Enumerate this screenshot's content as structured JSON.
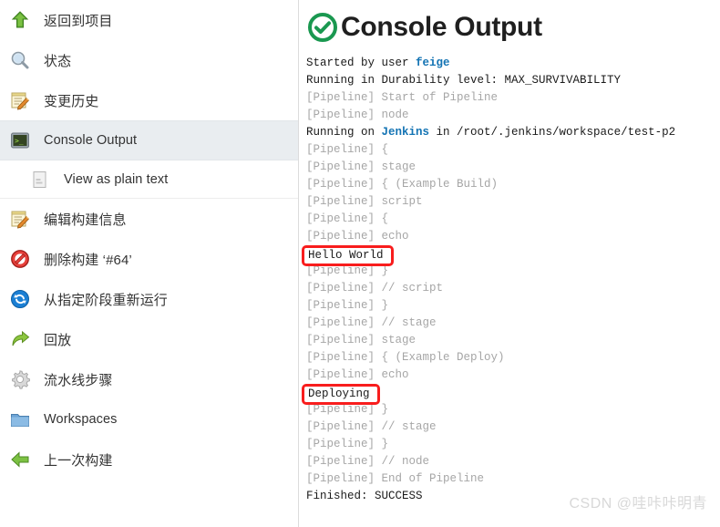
{
  "sidebar": {
    "items": [
      {
        "label": "返回到项目",
        "icon": "up-arrow-icon",
        "selected": false,
        "sub": false
      },
      {
        "label": "状态",
        "icon": "magnifier-icon",
        "selected": false,
        "sub": false
      },
      {
        "label": "变更历史",
        "icon": "notepad-pencil-icon",
        "selected": false,
        "sub": false
      },
      {
        "label": "Console Output",
        "icon": "terminal-icon",
        "selected": true,
        "sub": false
      },
      {
        "label": "View as plain text",
        "icon": "document-icon",
        "selected": false,
        "sub": true
      },
      {
        "label": "编辑构建信息",
        "icon": "notepad-pencil-icon",
        "selected": false,
        "sub": false
      },
      {
        "label": "删除构建 ‘#64’",
        "icon": "no-entry-icon",
        "selected": false,
        "sub": false
      },
      {
        "label": "从指定阶段重新运行",
        "icon": "refresh-circle-icon",
        "selected": false,
        "sub": false
      },
      {
        "label": "回放",
        "icon": "replay-arrow-icon",
        "selected": false,
        "sub": false
      },
      {
        "label": "流水线步骤",
        "icon": "gear-icon",
        "selected": false,
        "sub": false
      },
      {
        "label": "Workspaces",
        "icon": "folder-icon",
        "selected": false,
        "sub": false
      },
      {
        "label": "上一次构建",
        "icon": "left-arrow-icon",
        "selected": false,
        "sub": false
      }
    ]
  },
  "console": {
    "title": "Console Output",
    "status_icon": "success-check-icon",
    "status_color": "#1a9850",
    "highlight_color": "#f81d1d",
    "link_color": "#1474b4",
    "dim_color": "#a6a6a6",
    "lines": [
      {
        "segments": [
          {
            "text": "Started by user ",
            "style": "normal"
          },
          {
            "text": "feige",
            "style": "link"
          }
        ]
      },
      {
        "segments": [
          {
            "text": "Running in Durability level: MAX_SURVIVABILITY",
            "style": "normal"
          }
        ]
      },
      {
        "segments": [
          {
            "text": "[Pipeline] Start of Pipeline",
            "style": "dim"
          }
        ]
      },
      {
        "segments": [
          {
            "text": "[Pipeline] node",
            "style": "dim"
          }
        ]
      },
      {
        "segments": [
          {
            "text": "Running on ",
            "style": "normal"
          },
          {
            "text": "Jenkins",
            "style": "link"
          },
          {
            "text": " in /root/.jenkins/workspace/test-p2",
            "style": "normal"
          }
        ]
      },
      {
        "segments": [
          {
            "text": "[Pipeline] {",
            "style": "dim"
          }
        ]
      },
      {
        "segments": [
          {
            "text": "[Pipeline] stage",
            "style": "dim"
          }
        ]
      },
      {
        "segments": [
          {
            "text": "[Pipeline] { (Example Build)",
            "style": "dim"
          }
        ]
      },
      {
        "segments": [
          {
            "text": "[Pipeline] script",
            "style": "dim"
          }
        ]
      },
      {
        "segments": [
          {
            "text": "[Pipeline] {",
            "style": "dim"
          }
        ]
      },
      {
        "segments": [
          {
            "text": "[Pipeline] echo",
            "style": "dim"
          }
        ]
      },
      {
        "segments": [
          {
            "text": "Hello World",
            "style": "boxed"
          }
        ]
      },
      {
        "segments": [
          {
            "text": "[Pipeline] }",
            "style": "dim"
          }
        ]
      },
      {
        "segments": [
          {
            "text": "[Pipeline] // script",
            "style": "dim"
          }
        ]
      },
      {
        "segments": [
          {
            "text": "[Pipeline] }",
            "style": "dim"
          }
        ]
      },
      {
        "segments": [
          {
            "text": "[Pipeline] // stage",
            "style": "dim"
          }
        ]
      },
      {
        "segments": [
          {
            "text": "[Pipeline] stage",
            "style": "dim"
          }
        ]
      },
      {
        "segments": [
          {
            "text": "[Pipeline] { (Example Deploy)",
            "style": "dim"
          }
        ]
      },
      {
        "segments": [
          {
            "text": "[Pipeline] echo",
            "style": "dim"
          }
        ]
      },
      {
        "segments": [
          {
            "text": "Deploying",
            "style": "boxed"
          }
        ]
      },
      {
        "segments": [
          {
            "text": "[Pipeline] }",
            "style": "dim"
          }
        ]
      },
      {
        "segments": [
          {
            "text": "[Pipeline] // stage",
            "style": "dim"
          }
        ]
      },
      {
        "segments": [
          {
            "text": "[Pipeline] }",
            "style": "dim"
          }
        ]
      },
      {
        "segments": [
          {
            "text": "[Pipeline] // node",
            "style": "dim"
          }
        ]
      },
      {
        "segments": [
          {
            "text": "[Pipeline] End of Pipeline",
            "style": "dim"
          }
        ]
      },
      {
        "segments": [
          {
            "text": "Finished: SUCCESS",
            "style": "normal"
          }
        ]
      }
    ]
  },
  "watermark": {
    "text": "CSDN @哇咔咔明青"
  }
}
